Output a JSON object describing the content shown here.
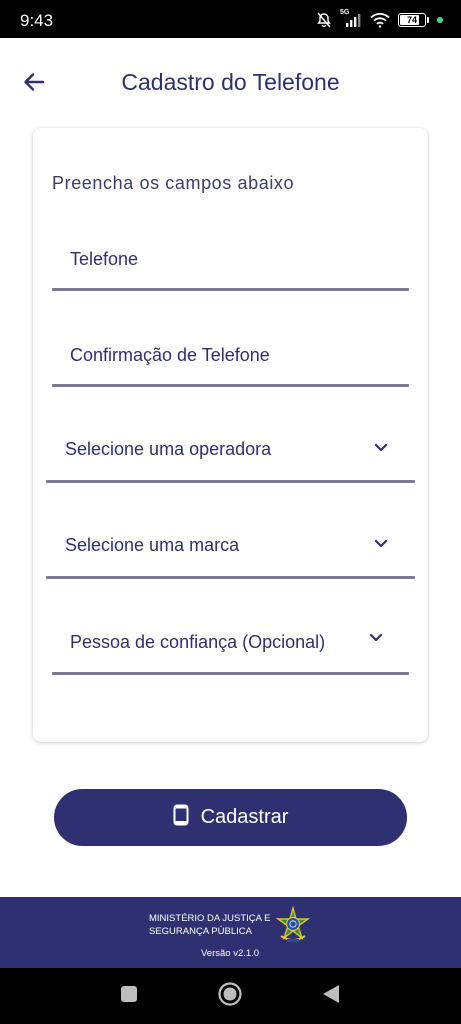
{
  "status_bar": {
    "time": "9:43",
    "network": "5G",
    "battery_level": "74",
    "battery_fraction": 0.74,
    "icons": [
      "bell-off-icon",
      "signal-icon",
      "wifi-icon",
      "battery-icon",
      "privacy-dot-icon"
    ]
  },
  "header": {
    "title": "Cadastro do Telefone",
    "back_icon": "arrow-left-icon"
  },
  "form": {
    "heading": "Preencha os campos abaixo",
    "fields": [
      {
        "label": "Telefone",
        "type": "text"
      },
      {
        "label": "Confirmação de Telefone",
        "type": "text"
      },
      {
        "label": "Selecione uma operadora",
        "type": "select"
      },
      {
        "label": "Selecione uma marca",
        "type": "select"
      },
      {
        "label": "Pessoa de confiança (Opcional)",
        "type": "select"
      }
    ]
  },
  "submit_button": {
    "label": "Cadastrar",
    "icon": "smartphone-icon"
  },
  "footer": {
    "org_line1": "MINISTÉRIO DA JUSTIÇA E",
    "org_line2": "SEGURANÇA PÚBLICA",
    "version": "Versão v2.1.0",
    "emblem": "coat-of-arms-icon"
  },
  "nav_bar": {
    "buttons": [
      "recents-square-icon",
      "home-circle-icon",
      "back-triangle-icon"
    ]
  },
  "colors": {
    "primary": "#2e3072",
    "text": "#2e3170",
    "underline": "#7b7a95",
    "status_bar": "#000000"
  }
}
